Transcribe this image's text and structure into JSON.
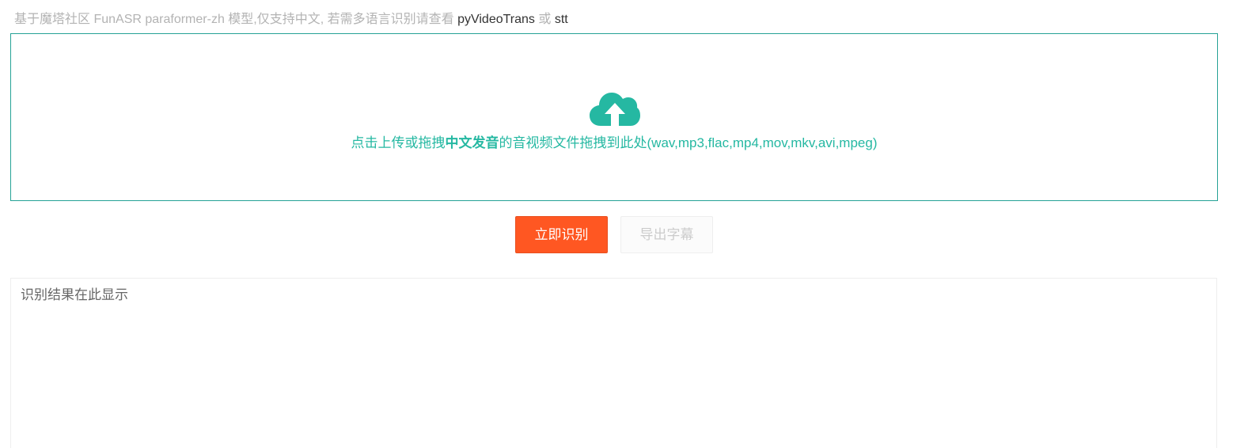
{
  "notice": {
    "prefix": "基于魔塔社区 FunASR paraformer-zh 模型,仅支持中文, 若需多语言识别请查看 ",
    "link1": "pyVideoTrans",
    "separator": " 或 ",
    "link2": "stt"
  },
  "upload": {
    "icon": "cloud-upload-icon",
    "text_before": "点击上传或拖拽",
    "text_bold": "中文发音",
    "text_after": "的音视频文件拖拽到此处(wav,mp3,flac,mp4,mov,mkv,avi,mpeg)"
  },
  "actions": {
    "recognize_label": "立即识别",
    "export_label": "导出字幕"
  },
  "result": {
    "placeholder": "识别结果在此显示",
    "value": ""
  },
  "colors": {
    "accent": "#25a296",
    "accent_text": "#25b8a2",
    "primary_button": "#ff5722",
    "muted_text": "#b3b3b3"
  }
}
